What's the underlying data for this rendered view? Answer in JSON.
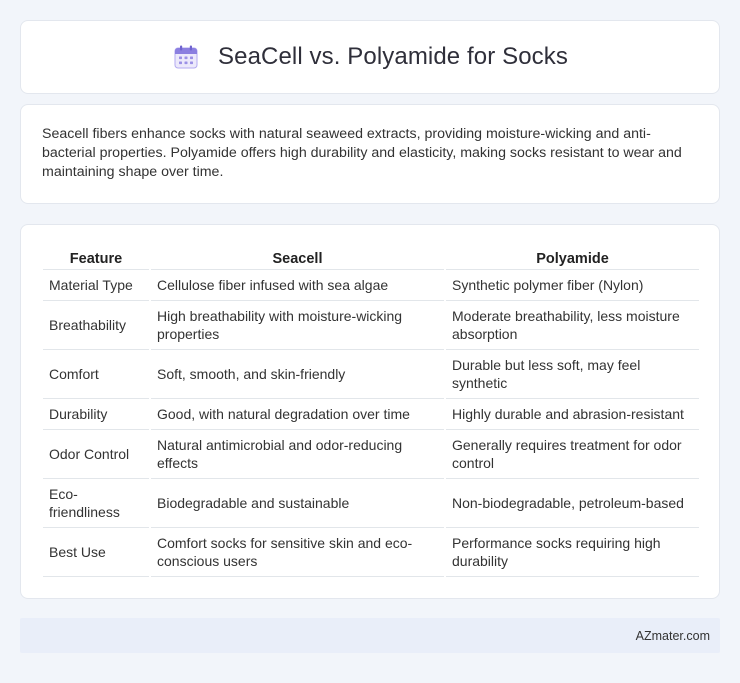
{
  "header": {
    "title": "SeaCell vs. Polyamide for Socks",
    "icon": "calendar-icon",
    "icon_color": "#8b7fe0"
  },
  "intro": {
    "text": "Seacell fibers enhance socks with natural seaweed extracts, providing moisture-wicking and anti-bacterial properties. Polyamide offers high durability and elasticity, making socks resistant to wear and maintaining shape over time."
  },
  "table": {
    "headers": [
      "Feature",
      "Seacell",
      "Polyamide"
    ],
    "rows": [
      [
        "Material Type",
        "Cellulose fiber infused with sea algae",
        "Synthetic polymer fiber (Nylon)"
      ],
      [
        "Breathability",
        "High breathability with moisture-wicking properties",
        "Moderate breathability, less moisture absorption"
      ],
      [
        "Comfort",
        "Soft, smooth, and skin-friendly",
        "Durable but less soft, may feel synthetic"
      ],
      [
        "Durability",
        "Good, with natural degradation over time",
        "Highly durable and abrasion-resistant"
      ],
      [
        "Odor Control",
        "Natural antimicrobial and odor-reducing effects",
        "Generally requires treatment for odor control"
      ],
      [
        "Eco-friendliness",
        "Biodegradable and sustainable",
        "Non-biodegradable, petroleum-based"
      ],
      [
        "Best Use",
        "Comfort socks for sensitive skin and eco-conscious users",
        "Performance socks requiring high durability"
      ]
    ]
  },
  "footer": {
    "text": "AZmater.com"
  }
}
